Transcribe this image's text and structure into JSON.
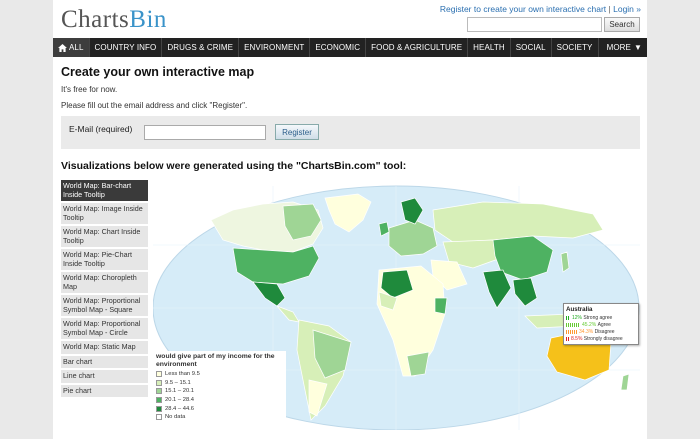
{
  "header": {
    "logo_charts": "Charts",
    "logo_bin": "Bin",
    "register_link": "Register to create your own interactive chart",
    "separator": " | ",
    "login_link": "Login »",
    "search_placeholder": "",
    "search_button": "Search"
  },
  "nav": {
    "all": "ALL",
    "items": [
      "COUNTRY INFO",
      "DRUGS & CRIME",
      "ENVIRONMENT",
      "ECONOMIC",
      "FOOD & AGRICULTURE",
      "HEALTH",
      "SOCIAL",
      "SOCIETY"
    ],
    "more": "MORE"
  },
  "main": {
    "title": "Create your own interactive map",
    "free_text": "It's free for now.",
    "instructions": "Please fill out the email address and click \"Register\".",
    "email_label": "E-Mail (required)",
    "email_value": "",
    "register_button": "Register",
    "viz_heading": "Visualizations below were generated using the \"ChartsBin.com\" tool:"
  },
  "viz_list": [
    "World Map: Bar-chart Inside Tooltip",
    "World Map: Image Inside Tooltip",
    "World Map: Chart Inside Tooltip",
    "World Map: Pie-Chart Inside Tooltip",
    "World Map: Choropleth Map",
    "World Map: Proportional Symbol Map - Square",
    "World Map: Proportional Symbol Map - Circle",
    "World Map: Static Map",
    "Bar chart",
    "Line chart",
    "Pie chart"
  ],
  "legend": {
    "title": "would give part of my income for the environment",
    "items": [
      {
        "label": "Less than 9.5",
        "color": "#ffffdd"
      },
      {
        "label": "9.5 – 15.1",
        "color": "#d7efb8"
      },
      {
        "label": "15.1 – 20.1",
        "color": "#9fd595"
      },
      {
        "label": "20.1 – 28.4",
        "color": "#4eb262"
      },
      {
        "label": "28.4 – 44.6",
        "color": "#1f8a3c"
      },
      {
        "label": "No data",
        "color": "#ffffff"
      }
    ]
  },
  "tooltip": {
    "country": "Australia",
    "rows": [
      {
        "value": "12%",
        "label": "Strong agree",
        "color": "#22aa22",
        "pct": 12
      },
      {
        "value": "45.2%",
        "label": "Agree",
        "color": "#66cc33",
        "pct": 45.2
      },
      {
        "value": "34.3%",
        "label": "Disagree",
        "color": "#ff9933",
        "pct": 34.3
      },
      {
        "value": "8.5%",
        "label": "Strongly disagree",
        "color": "#dd2222",
        "pct": 8.5
      }
    ]
  },
  "colors": {
    "nav_bg": "#222222",
    "ocean": "#d6ecf8",
    "australia_highlight": "#f5c11a"
  }
}
